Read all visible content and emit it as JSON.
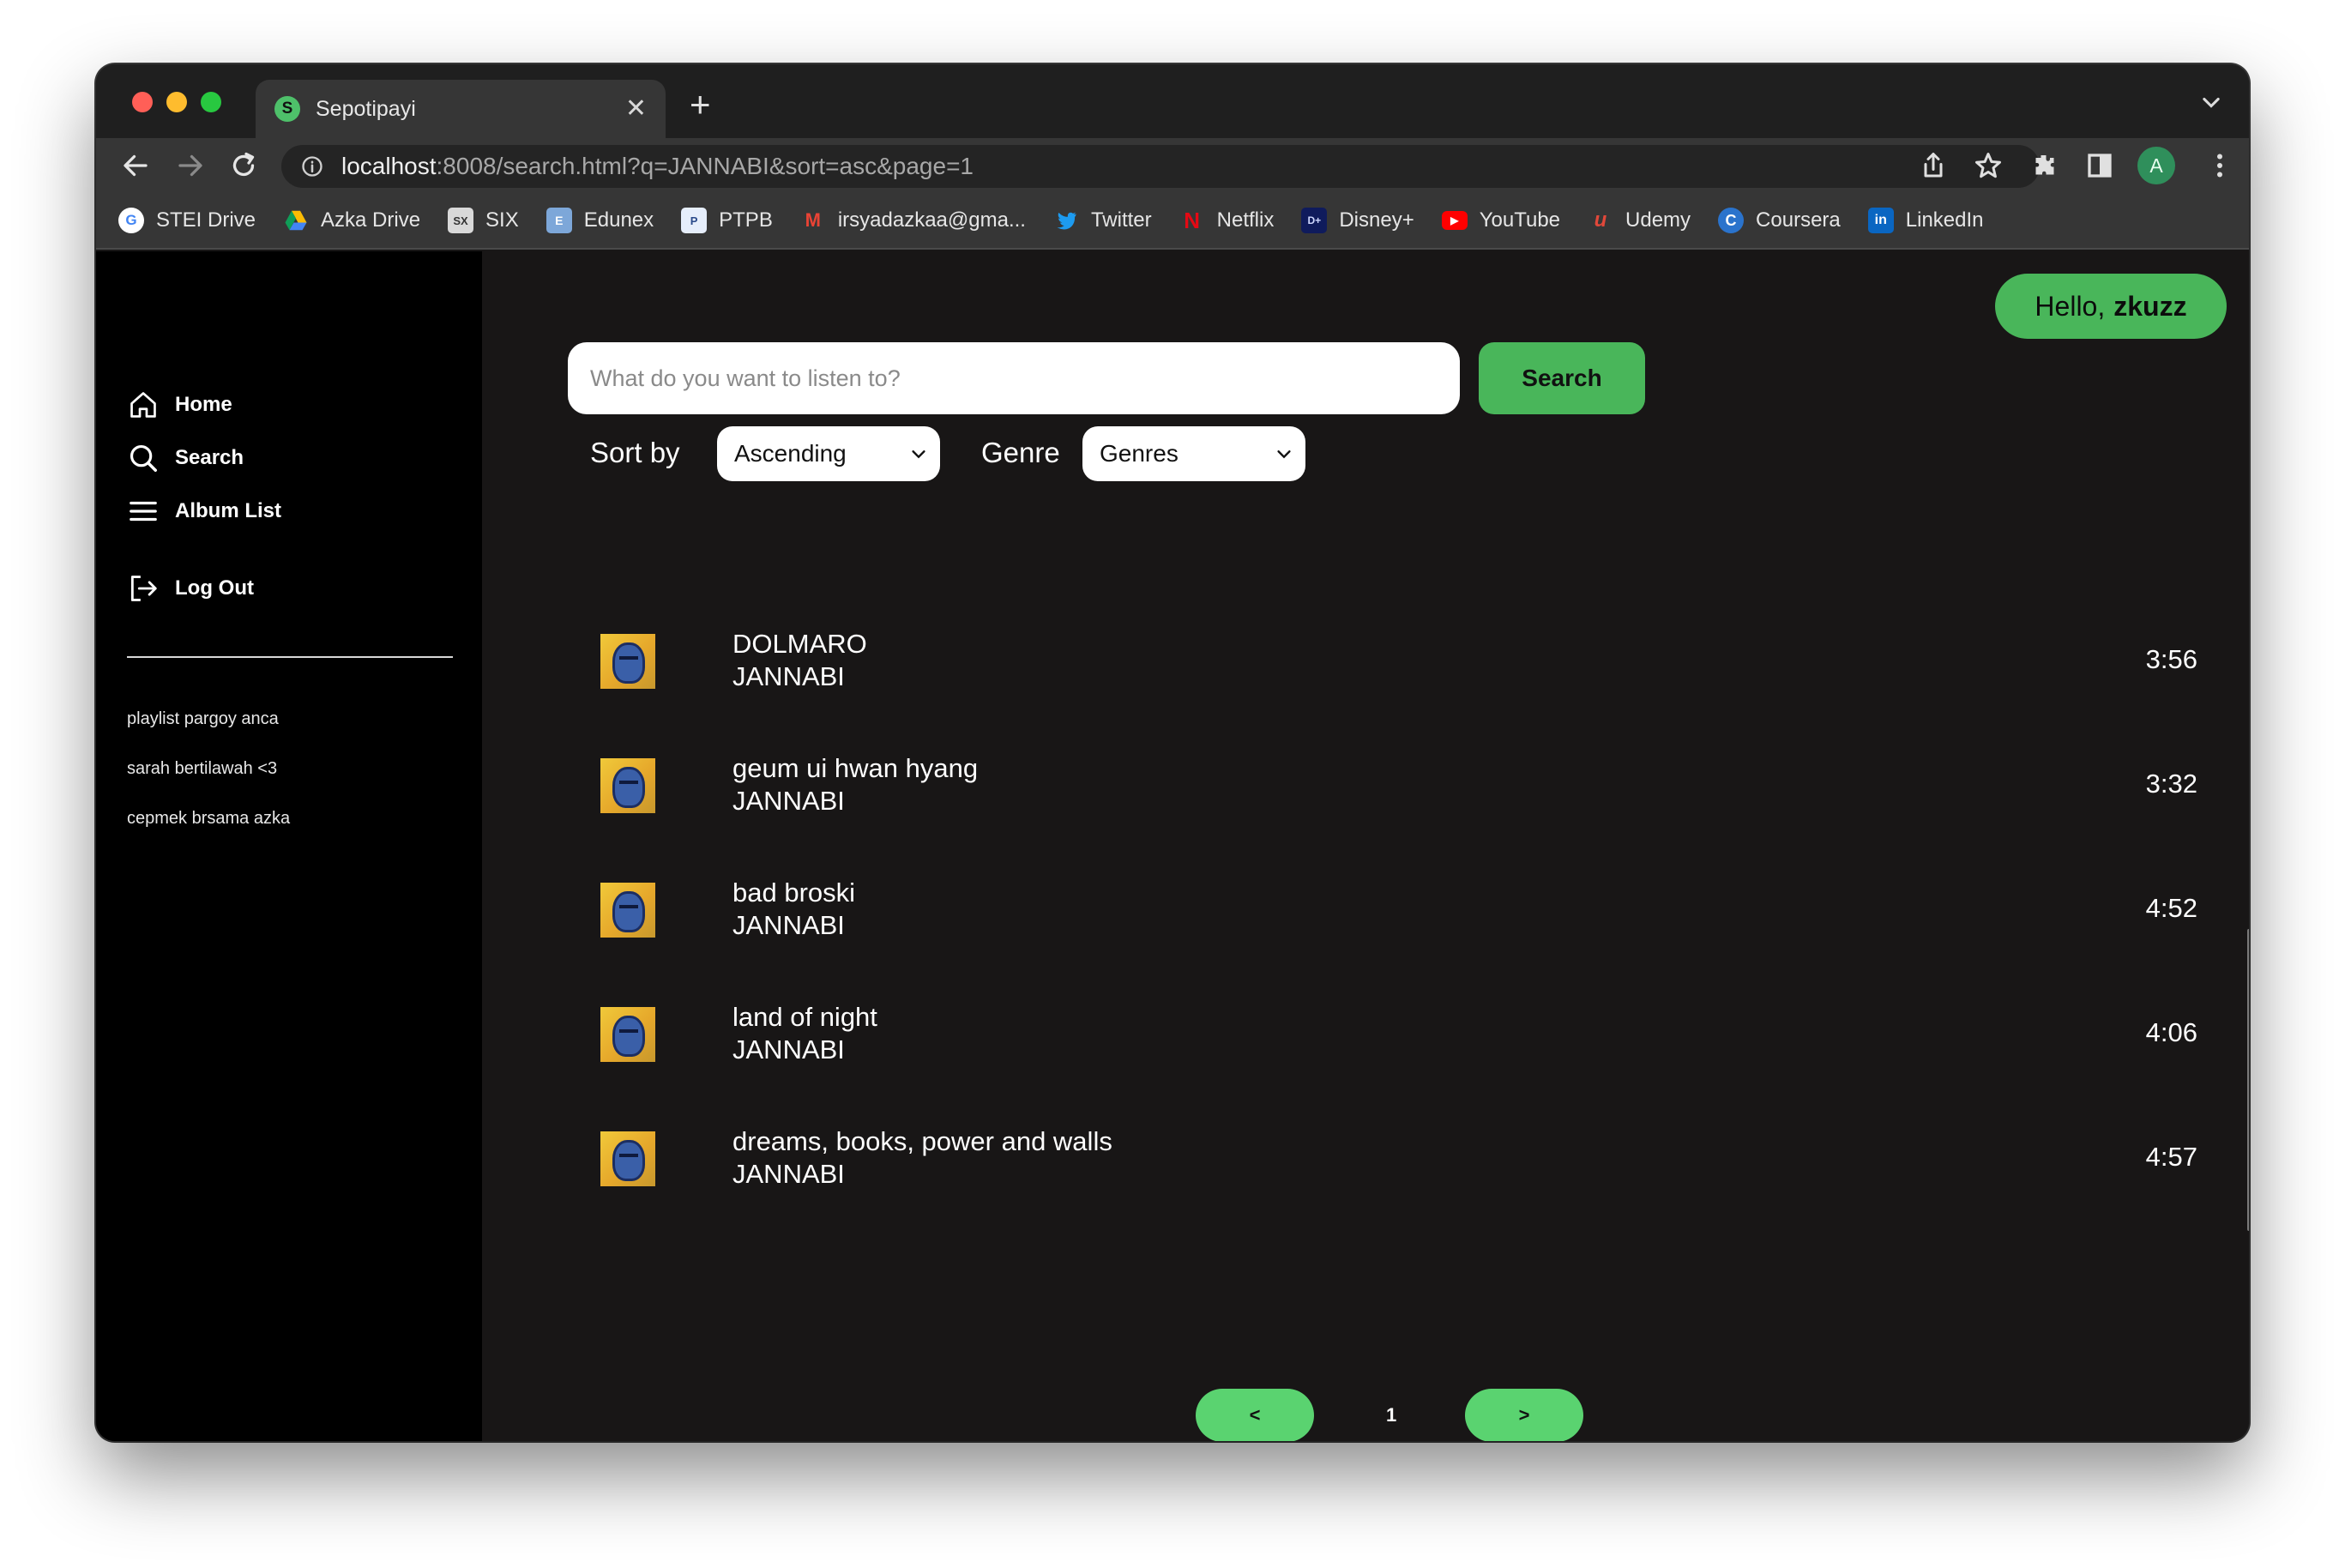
{
  "browser": {
    "tab_title": "Sepotipayi",
    "tab_favicon_letter": "S",
    "new_tab_symbol": "+",
    "url_host": "localhost",
    "url_rest": ":8008/search.html?q=JANNABI&sort=asc&page=1",
    "profile_initial": "A",
    "bookmarks": [
      {
        "label": "STEI Drive",
        "icon": "google-icon"
      },
      {
        "label": "Azka Drive",
        "icon": "drive-icon"
      },
      {
        "label": "SIX",
        "icon": "six-icon"
      },
      {
        "label": "Edunex",
        "icon": "edunex-icon"
      },
      {
        "label": "PTPB",
        "icon": "ptpb-icon"
      },
      {
        "label": "irsyadazkaa@gma...",
        "icon": "gmail-icon"
      },
      {
        "label": "Twitter",
        "icon": "twitter-icon"
      },
      {
        "label": "Netflix",
        "icon": "netflix-icon"
      },
      {
        "label": "Disney+",
        "icon": "disney-icon"
      },
      {
        "label": "YouTube",
        "icon": "youtube-icon"
      },
      {
        "label": "Udemy",
        "icon": "udemy-icon"
      },
      {
        "label": "Coursera",
        "icon": "coursera-icon"
      },
      {
        "label": "LinkedIn",
        "icon": "linkedin-icon"
      }
    ]
  },
  "sidebar": {
    "nav": [
      {
        "label": "Home",
        "icon": "home-icon"
      },
      {
        "label": "Search",
        "icon": "search-icon"
      },
      {
        "label": "Album List",
        "icon": "menu-icon"
      }
    ],
    "logout_label": "Log Out",
    "playlists": [
      "playlist pargoy anca",
      "sarah bertilawah <3",
      "cepmek brsama azka"
    ]
  },
  "header": {
    "greeting": "Hello,",
    "username": "zkuzz"
  },
  "search": {
    "placeholder": "What do you want to listen to?",
    "value": "",
    "button_label": "Search",
    "sort_label": "Sort by",
    "sort_value": "Ascending",
    "genre_label": "Genre",
    "genre_value": "Genres"
  },
  "songs": [
    {
      "title": "DOLMARO",
      "artist": "JANNABI",
      "duration": "3:56"
    },
    {
      "title": "geum ui hwan hyang",
      "artist": "JANNABI",
      "duration": "3:32"
    },
    {
      "title": "bad broski",
      "artist": "JANNABI",
      "duration": "4:52"
    },
    {
      "title": "land of night",
      "artist": "JANNABI",
      "duration": "4:06"
    },
    {
      "title": "dreams, books, power and walls",
      "artist": "JANNABI",
      "duration": "4:57"
    }
  ],
  "pagination": {
    "prev_label": "<",
    "current_page": "1",
    "next_label": ">"
  },
  "colors": {
    "accent_green": "#49b65a",
    "page_bg": "#181616",
    "sidebar_bg": "#000000"
  }
}
